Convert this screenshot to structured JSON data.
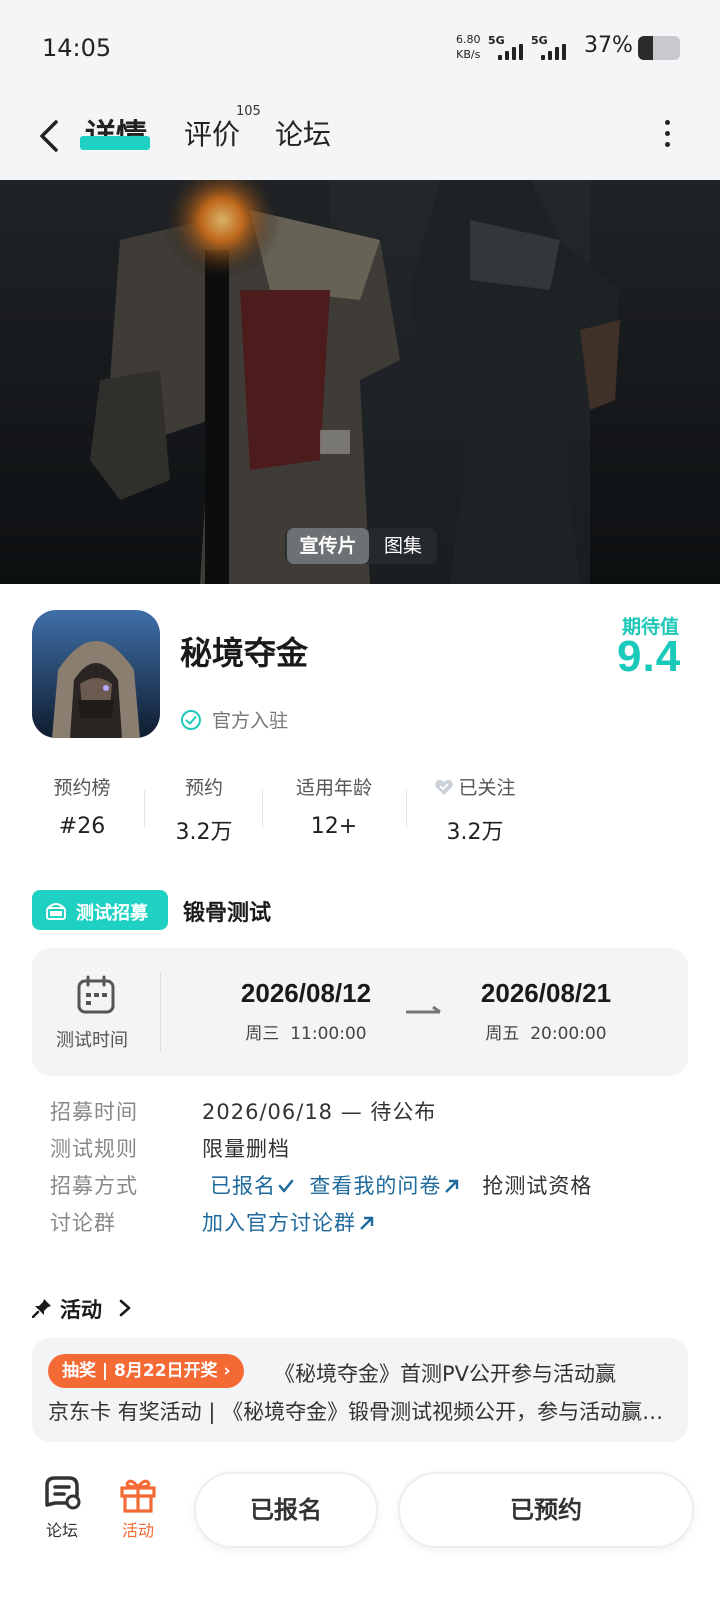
{
  "status_bar": {
    "time": "14:05",
    "net_speed_value": "6.80",
    "net_speed_unit": "KB/s",
    "signal_1": "5G",
    "signal_2": "5G",
    "battery": "37%"
  },
  "nav": {
    "tabs": [
      {
        "label": "详情",
        "active": true
      },
      {
        "label": "评价",
        "badge": "105"
      },
      {
        "label": "论坛"
      }
    ]
  },
  "hero": {
    "media_tabs": [
      {
        "label": "宣传片",
        "active": true
      },
      {
        "label": "图集"
      }
    ]
  },
  "game": {
    "title": "秘境夺金",
    "verified_label": "官方入驻",
    "expectation_label": "期待值",
    "expectation_score": "9.4"
  },
  "stats": [
    {
      "label": "预约榜",
      "value": "#26"
    },
    {
      "label": "预约",
      "value": "3.2万"
    },
    {
      "label": "适用年龄",
      "value": "12+"
    },
    {
      "label": "已关注",
      "value": "3.2万"
    }
  ],
  "recruitment": {
    "badge": "测试招募",
    "test_name": "锻骨测试",
    "time_label": "测试时间",
    "start": {
      "date": "2026/08/12",
      "weekday": "周三",
      "time": "11:00:00"
    },
    "end": {
      "date": "2026/08/21",
      "weekday": "周五",
      "time": "20:00:00"
    },
    "rows": {
      "recruit_time": {
        "key": "招募时间",
        "value": "2026/06/18 — 待公布"
      },
      "test_rule": {
        "key": "测试规则",
        "value": "限量删档"
      },
      "method": {
        "key": "招募方式",
        "registered": "已报名",
        "questionnaire": "查看我的问卷",
        "grab": "抢测试资格"
      },
      "group": {
        "key": "讨论群",
        "join": "加入官方讨论群"
      }
    }
  },
  "activity": {
    "title": "活动",
    "badge": "抽奖 | 8月22日开奖",
    "line1": "《秘境夺金》首测PV公开参与活动赢",
    "line2": "京东卡 有奖活动 | 《秘境夺金》锻骨测试视频公开，参与活动赢京东卡"
  },
  "bottom_bar": {
    "forum_label": "论坛",
    "activity_label": "活动",
    "registered_button": "已报名",
    "reserved_button": "已预约"
  },
  "colors": {
    "accent": "#1fd1c2",
    "activity_orange": "#f46a35",
    "link_blue": "#1f6b9d"
  }
}
